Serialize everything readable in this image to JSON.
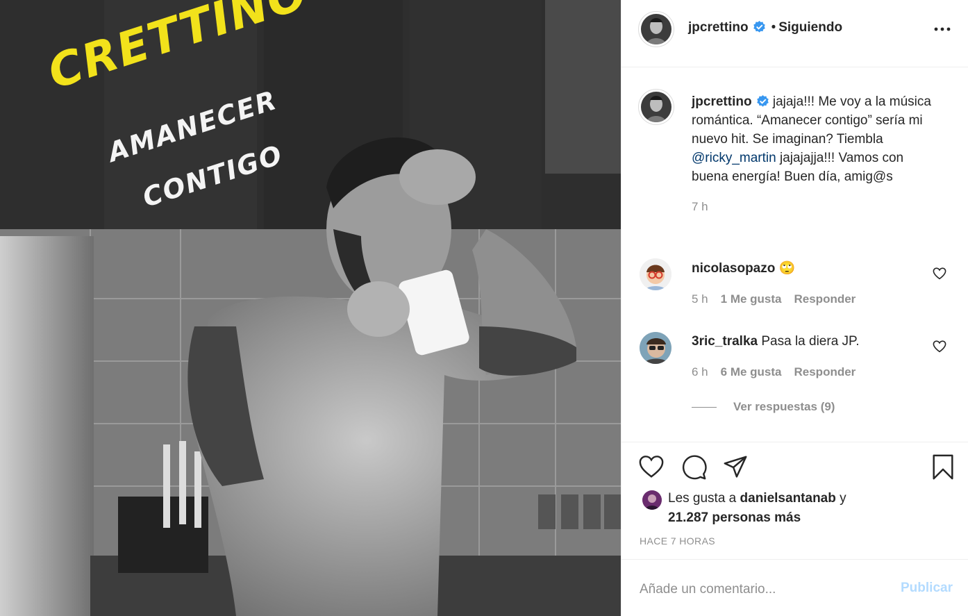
{
  "photo": {
    "artist_text": "CRETTINO",
    "song_line_1": "AMANECER",
    "song_line_2": "CONTIGO"
  },
  "header": {
    "username": "jpcrettino",
    "separator": "•",
    "follow_status": "Siguiendo"
  },
  "caption": {
    "username": "jpcrettino",
    "text_before_mention": "jajaja!!! Me voy a la música romántica. “Amanecer contigo” sería mi nuevo hit. Se imaginan? Tiembla ",
    "mention": "@ricky_martin",
    "text_after_mention": " jajajajja!!! Vamos con buena energía! Buen día, amig@s",
    "time": "7 h"
  },
  "comments": [
    {
      "username": "nicolasopazo",
      "text": "🙄",
      "time": "5 h",
      "likes": "1 Me gusta",
      "reply": "Responder"
    },
    {
      "username": "3ric_tralka",
      "text": "Pasa la diera JP.",
      "time": "6 h",
      "likes": "6 Me gusta",
      "reply": "Responder"
    }
  ],
  "view_replies": "Ver respuestas (9)",
  "likes": {
    "prefix": "Les gusta a ",
    "user": "danielsantanab",
    "joiner": " y",
    "others": "21.287 personas más"
  },
  "timestamp": "HACE 7 HORAS",
  "comment_box": {
    "placeholder": "Añade un comentario...",
    "publish": "Publicar"
  },
  "colors": {
    "verified": "#3897f0",
    "mention": "#00376b",
    "publish_disabled": "#b3dbff",
    "muted": "#8e8e8e",
    "cover_yellow": "#f2e21b"
  }
}
